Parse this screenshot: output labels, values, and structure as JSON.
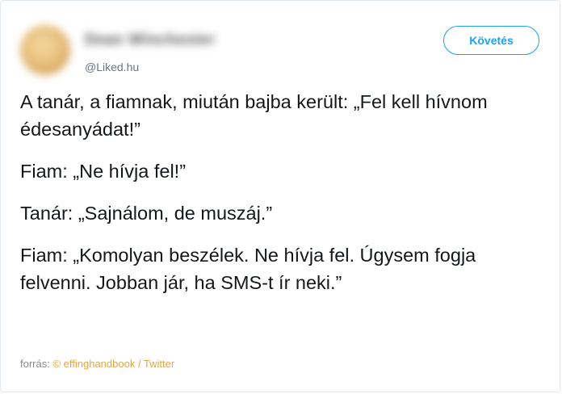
{
  "author": {
    "name": "Dean Winchester",
    "handle": "@Liked.hu"
  },
  "follow_label": "Követés",
  "paragraphs": [
    "A tanár, a fiamnak, miután bajba került: „Fel kell hívnom édesanyádat!”",
    "Fiam: „Ne hívja fel!”",
    "Tanár: „Sajnálom, de muszáj.”",
    "Fiam: „Komolyan beszélek. Ne hívja fel. Úgysem fogja felvenni. Jobban jár, ha SMS-t ír neki.”"
  ],
  "source": {
    "prefix": "forrás:",
    "link_text": "© effinghandbook / Twitter"
  },
  "colors": {
    "accent": "#1da1f2",
    "source_link": "#e0a64a",
    "border": "#e1e8ed"
  }
}
